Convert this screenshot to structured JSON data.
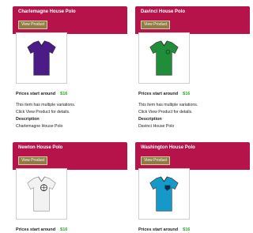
{
  "products": [
    {
      "title": "Charlemagne House Polo",
      "button": "View Product",
      "price_label": "Prices start around",
      "price": "$16",
      "variation_note": "This item has multiple variations.",
      "details_note": "Click View Product for details.",
      "desc_heading": "Description",
      "desc_text": "Charlemagne House Polo",
      "shirt_color": "#4b1b86"
    },
    {
      "title": "Davinci House Polo",
      "button": "View Product",
      "price_label": "Prices start around",
      "price": "$16",
      "variation_note": "This item has multiple variations.",
      "details_note": "Click View Product for details.",
      "desc_heading": "Description",
      "desc_text": "Davinci House Polo",
      "shirt_color": "#1f8d3a"
    },
    {
      "title": "Newton House Polo",
      "button": "View Product",
      "price_label": "Prices start around",
      "price": "$16",
      "shirt_color": "#f2f2f2"
    },
    {
      "title": "Washington House Polo",
      "button": "View Product",
      "price_label": "Prices start around",
      "price": "$16",
      "shirt_color": "#1499c9"
    }
  ],
  "colors": {
    "header": "#b5134a",
    "button": "#8f7c43",
    "price": "#2aa52a"
  }
}
